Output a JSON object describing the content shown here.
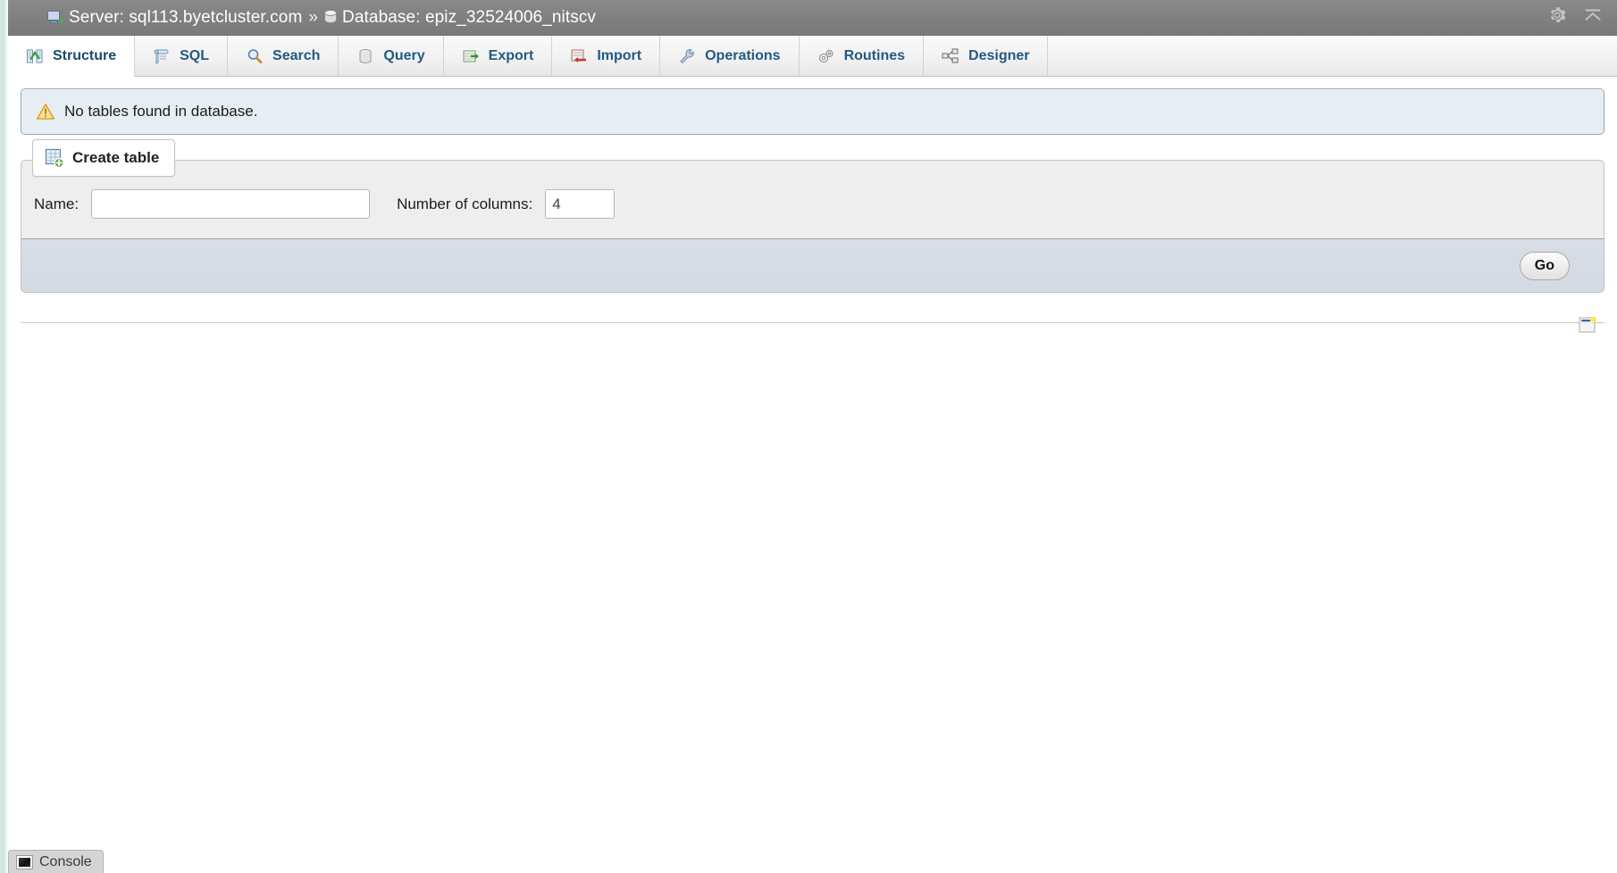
{
  "topbar": {
    "server_icon": "server-icon",
    "server_label": "Server: sql113.byetcluster.com",
    "separator": "»",
    "database_icon": "database-icon",
    "database_label": "Database: epiz_32524006_nitscv",
    "settings_icon": "gear-icon",
    "collapse_icon": "collapse-up-icon"
  },
  "tabs": [
    {
      "label": "Structure",
      "icon": "structure-icon",
      "active": true
    },
    {
      "label": "SQL",
      "icon": "sql-icon",
      "active": false
    },
    {
      "label": "Search",
      "icon": "search-icon",
      "active": false
    },
    {
      "label": "Query",
      "icon": "query-icon",
      "active": false
    },
    {
      "label": "Export",
      "icon": "export-icon",
      "active": false
    },
    {
      "label": "Import",
      "icon": "import-icon",
      "active": false
    },
    {
      "label": "Operations",
      "icon": "wrench-icon",
      "active": false
    },
    {
      "label": "Routines",
      "icon": "routines-icon",
      "active": false
    },
    {
      "label": "Designer",
      "icon": "designer-icon",
      "active": false
    }
  ],
  "notice": {
    "icon": "warning-icon",
    "message": "No tables found in database."
  },
  "create_table": {
    "legend_label": "Create table",
    "legend_icon": "create-table-icon",
    "name_label": "Name:",
    "name_value": "",
    "name_placeholder": "",
    "columns_label": "Number of columns:",
    "columns_value": "4",
    "go_label": "Go"
  },
  "footer": {
    "window_icon": "console-window-icon"
  },
  "console": {
    "label": "Console",
    "icon": "console-icon"
  },
  "colors": {
    "topbar_bg": "#808080",
    "tab_text": "#235a81",
    "notice_bg": "#e6eef4",
    "notice_border": "#8fa8bd",
    "fieldset_bg": "#eeeeee",
    "go_bar_bg": "#d3dae2",
    "left_strip": "#cfe2dd"
  }
}
